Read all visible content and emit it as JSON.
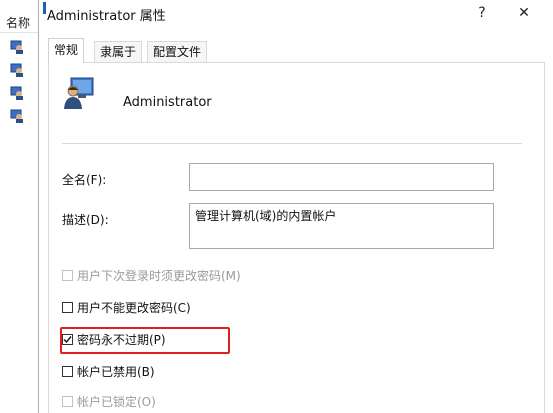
{
  "background_window": {
    "column_header": "名称"
  },
  "dialog": {
    "title": "Administrator 属性",
    "help_glyph": "?",
    "close_glyph": "✕",
    "tabs": [
      {
        "label": "常规",
        "active": true
      },
      {
        "label": "隶属于",
        "active": false
      },
      {
        "label": "配置文件",
        "active": false
      }
    ],
    "user": {
      "icon": "user-monitor-icon",
      "name": "Administrator"
    },
    "fields": {
      "full_name": {
        "label": "全名(F):",
        "value": ""
      },
      "description": {
        "label": "描述(D):",
        "value": "管理计算机(域)的内置帐户"
      }
    },
    "checkboxes": [
      {
        "label": "用户下次登录时须更改密码(M)",
        "checked": false,
        "enabled": false
      },
      {
        "label": "用户不能更改密码(C)",
        "checked": false,
        "enabled": true
      },
      {
        "label": "密码永不过期(P)",
        "checked": true,
        "enabled": true
      },
      {
        "label": "帐户已禁用(B)",
        "checked": false,
        "enabled": true
      },
      {
        "label": "帐户已锁定(O)",
        "checked": false,
        "enabled": false
      }
    ],
    "check_glyph": "✓",
    "colors": {
      "highlight": "#e02020",
      "disabled_text": "#9a9a9a",
      "border": "#d9d9d9"
    }
  }
}
